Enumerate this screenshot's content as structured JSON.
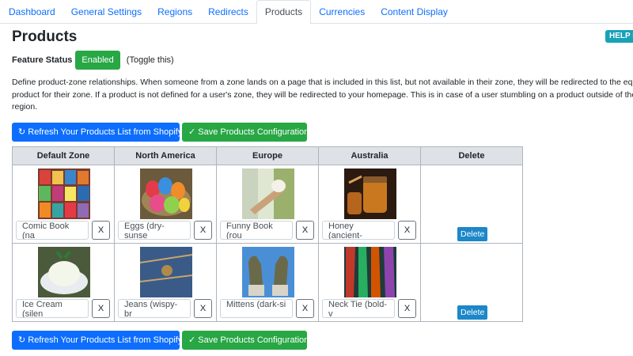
{
  "tabs": [
    "Dashboard",
    "General Settings",
    "Regions",
    "Redirects",
    "Products",
    "Currencies",
    "Content Display"
  ],
  "active_tab": "Products",
  "help_label": "HELP D",
  "title": "Products",
  "feature": {
    "label": "Feature Status",
    "status": "Enabled",
    "toggle_hint": "(Toggle this)"
  },
  "description": [
    "Define product-zone relationships. When someone from a zone lands on a page that is included in this list, but not available in their zone, they will be redirected to the equiva",
    "product for their zone. If a product is not defined for a user's zone, they will be redirected to your homepage. This is in case of a user stumbling on a product outside of their",
    "region."
  ],
  "buttons": {
    "refresh": "↻ Refresh Your Products List from Shopify",
    "save": "✓ Save Products Configuration"
  },
  "table": {
    "headers": [
      "Default Zone",
      "North America",
      "Europe",
      "Australia",
      "Delete"
    ],
    "rows": [
      {
        "cells": [
          {
            "value": "Comic Book (na",
            "image": "comic-book-image"
          },
          {
            "value": "Eggs (dry-sunse",
            "image": "eggs-image"
          },
          {
            "value": "Funny Book (rou",
            "image": "funny-book-image"
          },
          {
            "value": "Honey (ancient-",
            "image": "honey-image"
          }
        ],
        "delete_label": "Delete"
      },
      {
        "cells": [
          {
            "value": "Ice Cream (silen",
            "image": "ice-cream-image"
          },
          {
            "value": "Jeans (wispy-br",
            "image": "jeans-image"
          },
          {
            "value": "Mittens (dark-si",
            "image": "mittens-image"
          },
          {
            "value": "Neck Tie (bold-v",
            "image": "neck-tie-image"
          }
        ],
        "delete_label": "Delete"
      }
    ],
    "clear_label": "X"
  },
  "colors": {
    "primary": "#0d6efd",
    "success": "#28a745",
    "info": "#17a2b8",
    "delete": "#1c87c9"
  }
}
